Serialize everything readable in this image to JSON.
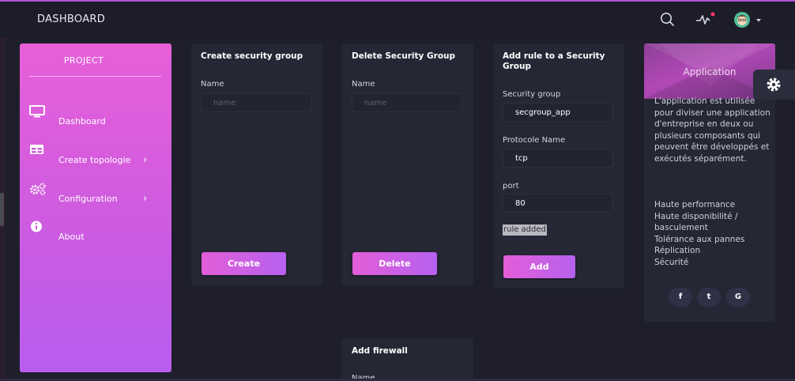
{
  "header": {
    "brand": "DASHBOARD",
    "icons": [
      "search-icon",
      "activity-icon",
      "avatar"
    ]
  },
  "sidebar": {
    "title": "PROJECT",
    "items": [
      {
        "label": "Dashboard",
        "icon": "monitor-icon",
        "chevron": ""
      },
      {
        "label": "Create topologie",
        "icon": "table-icon",
        "chevron": "›"
      },
      {
        "label": "Configuration",
        "icon": "cogs-icon",
        "chevron": "›"
      },
      {
        "label": "About",
        "icon": "info-icon",
        "chevron": ""
      }
    ]
  },
  "create_group": {
    "title": "Create security group",
    "name_label": "Name",
    "name_placeholder": "name",
    "button": "Create"
  },
  "delete_group": {
    "title": "Delete Security Group",
    "name_label": "Name",
    "name_placeholder": "name",
    "button": "Delete"
  },
  "add_rule": {
    "title": "Add rule to a Security Group",
    "group_label": "Security group",
    "group_value": "secgroup_app",
    "protocol_label": "Protocole Name",
    "protocol_value": "tcp",
    "port_label": "port",
    "port_value": "80",
    "status": "rule added",
    "button": "Add"
  },
  "firewall": {
    "title": "Add firewall",
    "name_label": "Name"
  },
  "application": {
    "title": "Application",
    "description": "L'application est utilisée pour diviser une application d'entreprise en deux ou plusieurs composants qui peuvent être développés et exécutés séparément.",
    "features": [
      "Haute performance",
      "Haute disponibilité / basculement",
      "Tolérance aux pannes",
      "Réplication",
      "Sécurité"
    ],
    "social": [
      {
        "icon": "facebook-icon",
        "glyph": "f"
      },
      {
        "icon": "twitter-icon",
        "glyph": "t"
      },
      {
        "icon": "google-icon",
        "glyph": "G"
      }
    ]
  },
  "colors": {
    "accent_start": "#e35ed8",
    "accent_end": "#b761ef",
    "background": "#1e1f2b",
    "card": "#252735"
  }
}
